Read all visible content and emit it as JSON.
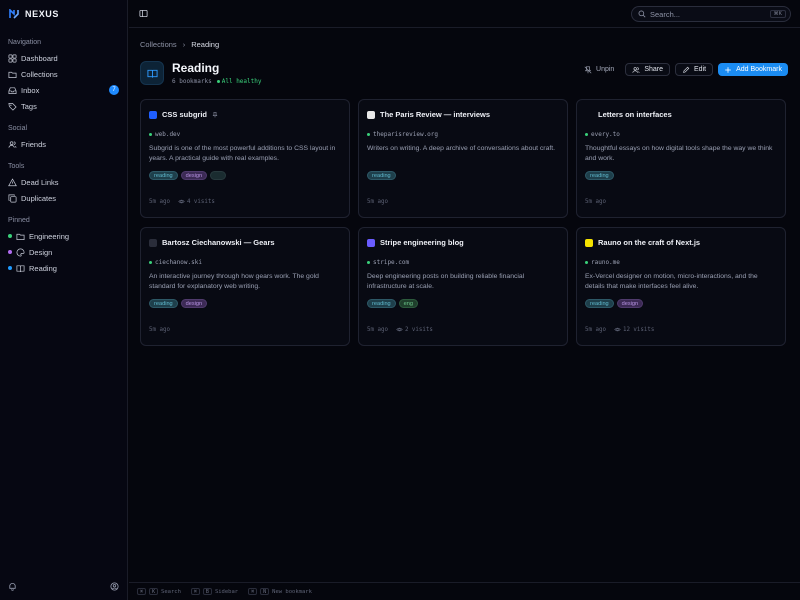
{
  "app": {
    "name": "NEXUS"
  },
  "sidebar": {
    "sections": [
      {
        "title": "Navigation",
        "items": [
          {
            "label": "Dashboard",
            "icon": "dashboard-icon"
          },
          {
            "label": "Collections",
            "icon": "folder-icon"
          },
          {
            "label": "Inbox",
            "icon": "inbox-icon",
            "badge": "7"
          },
          {
            "label": "Tags",
            "icon": "tag-icon"
          }
        ]
      },
      {
        "title": "Social",
        "items": [
          {
            "label": "Friends",
            "icon": "users-icon"
          }
        ]
      },
      {
        "title": "Tools",
        "items": [
          {
            "label": "Dead Links",
            "icon": "warning-icon"
          },
          {
            "label": "Duplicates",
            "icon": "copy-icon"
          }
        ]
      },
      {
        "title": "Pinned",
        "items": [
          {
            "label": "Engineering",
            "icon": "folder-icon",
            "dot": "#3ad07a"
          },
          {
            "label": "Design",
            "icon": "palette-icon",
            "dot": "#b06cf0"
          },
          {
            "label": "Reading",
            "icon": "book-icon",
            "dot": "#1f9bff"
          }
        ]
      }
    ]
  },
  "search": {
    "placeholder": "Search...",
    "shortcut": "⌘K"
  },
  "breadcrumb": {
    "parent": "Collections",
    "sep": "›",
    "current": "Reading"
  },
  "collection": {
    "title": "Reading",
    "count": "6 bookmarks",
    "health": "All healthy"
  },
  "actions": {
    "unpin": "Unpin",
    "share": "Share",
    "edit": "Edit",
    "add": "Add Bookmark"
  },
  "cards": [
    {
      "title": "CSS subgrid",
      "pinned": true,
      "favicon_color": "#1f5fff",
      "domain": "web.dev",
      "desc": "Subgrid is one of the most powerful additions to CSS layout in years. A practical guide with real examples.",
      "tags": [
        "reading",
        "design",
        ""
      ],
      "time": "5m ago",
      "visits": "4 visits"
    },
    {
      "title": "The Paris Review — interviews",
      "favicon_color": "#e8e8e8",
      "domain": "theparisreview.org",
      "desc": "Writers on writing. A deep archive of conversations about craft.",
      "tags": [
        "reading"
      ],
      "time": "5m ago",
      "visits": ""
    },
    {
      "title": "Letters on interfaces",
      "favicon_color": "#080a13",
      "domain": "every.to",
      "desc": "Thoughtful essays on how digital tools shape the way we think and work.",
      "tags": [
        "reading"
      ],
      "time": "5m ago",
      "visits": ""
    },
    {
      "title": "Bartosz Ciechanowski — Gears",
      "favicon_color": "#2a2d3a",
      "domain": "ciechanow.ski",
      "desc": "An interactive journey through how gears work. The gold standard for explanatory web writing.",
      "tags": [
        "reading",
        "design"
      ],
      "time": "5m ago",
      "visits": ""
    },
    {
      "title": "Stripe engineering blog",
      "favicon_color": "#6a5cff",
      "domain": "stripe.com",
      "desc": "Deep engineering posts on building reliable financial infrastructure at scale.",
      "tags": [
        "reading",
        "eng"
      ],
      "time": "5m ago",
      "visits": "2 visits"
    },
    {
      "title": "Rauno on the craft of Next.js",
      "favicon_color": "#f5e200",
      "domain": "rauno.me",
      "desc": "Ex-Vercel designer on motion, micro-interactions, and the details that make interfaces feel alive.",
      "tags": [
        "reading",
        "design"
      ],
      "time": "5m ago",
      "visits": "12 visits"
    }
  ],
  "statusbar": [
    {
      "key": "⌘",
      "key2": "K",
      "label": "Search"
    },
    {
      "key": "⌘",
      "key2": "B",
      "label": "Sidebar"
    },
    {
      "key": "⌘",
      "key2": "N",
      "label": "New bookmark"
    }
  ],
  "colors": {
    "accent": "#1b8cf2",
    "healthy": "#3ad07a",
    "background": "#05060d"
  }
}
